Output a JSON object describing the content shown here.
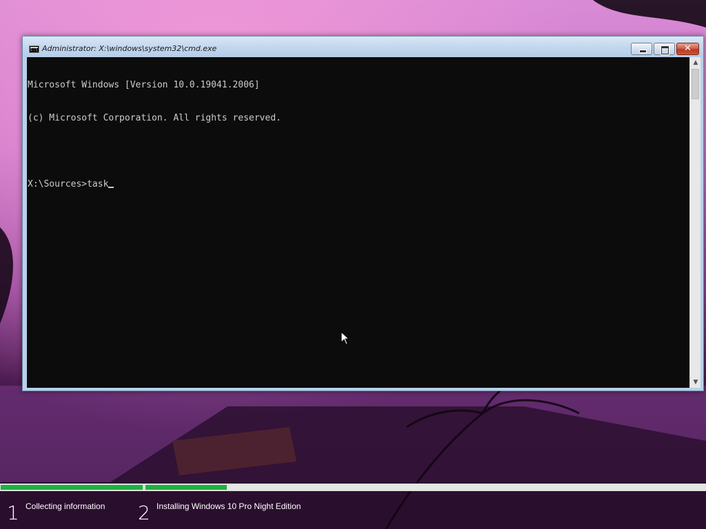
{
  "window": {
    "title": "Administrator: X:\\windows\\system32\\cmd.exe",
    "icon": "cmd-icon",
    "close_glyph": "✕"
  },
  "console": {
    "lines": [
      "Microsoft Windows [Version 10.0.19041.2006]",
      "(c) Microsoft Corporation. All rights reserved.",
      "",
      "X:\\Sources>task"
    ]
  },
  "scrollbar": {
    "up_glyph": "▲",
    "down_glyph": "▼"
  },
  "setup": {
    "steps": [
      {
        "number": "1",
        "label": "Collecting information",
        "progress": 1.0
      },
      {
        "number": "2",
        "label": "Installing Windows 10 Pro Night Edition",
        "progress": 0.145
      }
    ]
  },
  "colors": {
    "console_bg": "#0c0c0c",
    "console_text": "#cccccc",
    "progress_fill": "#20b043"
  }
}
